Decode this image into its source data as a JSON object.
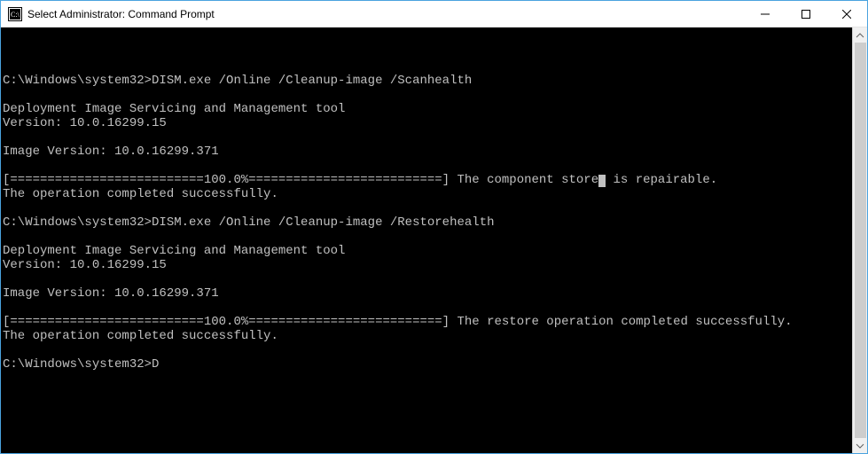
{
  "window": {
    "title": "Select Administrator: Command Prompt"
  },
  "terminal": {
    "lines": [
      "",
      "",
      "",
      "C:\\Windows\\system32>DISM.exe /Online /Cleanup-image /Scanhealth",
      "",
      "Deployment Image Servicing and Management tool",
      "Version: 10.0.16299.15",
      "",
      "Image Version: 10.0.16299.371",
      "",
      "[==========================100.0%==========================] The component store is repairable.",
      "The operation completed successfully.",
      "",
      "C:\\Windows\\system32>DISM.exe /Online /Cleanup-image /Restorehealth",
      "",
      "Deployment Image Servicing and Management tool",
      "Version: 10.0.16299.15",
      "",
      "Image Version: 10.0.16299.371",
      "",
      "[==========================100.0%==========================] The restore operation completed successfully.",
      "The operation completed successfully.",
      "",
      "C:\\Windows\\system32>D"
    ],
    "cursor_line_index": 10,
    "cursor_col_after": "[==========================100.0%==========================] The component store"
  }
}
